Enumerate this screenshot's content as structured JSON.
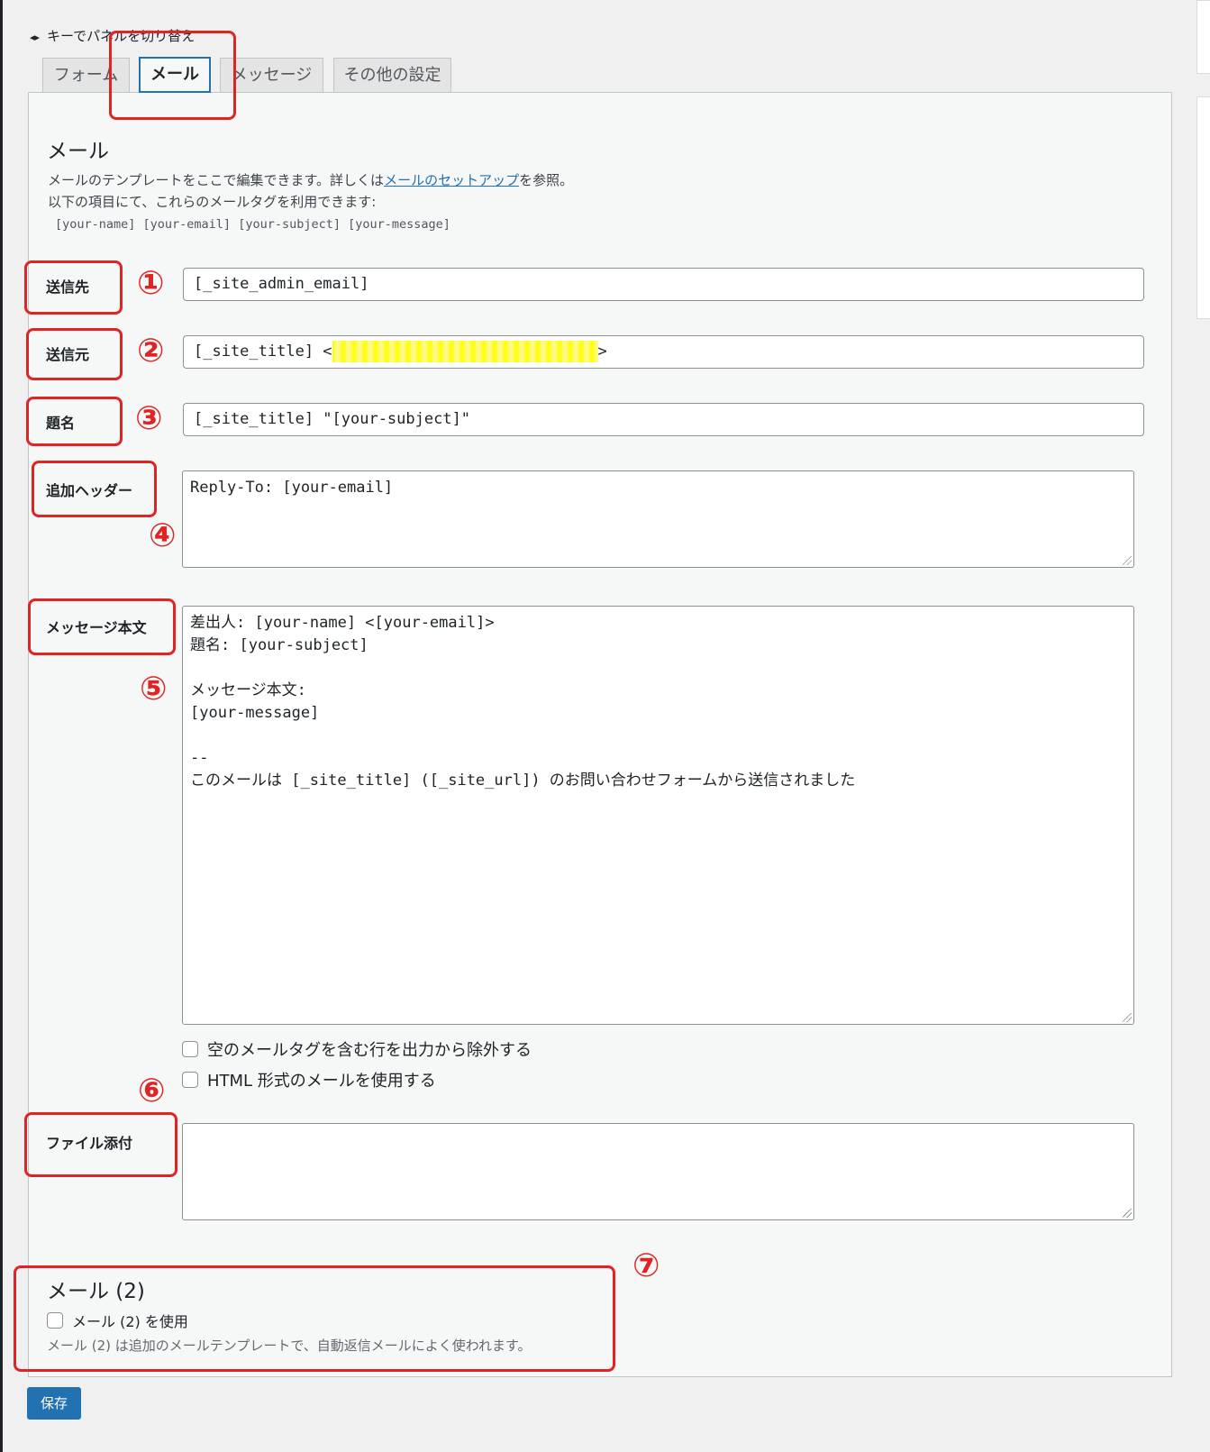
{
  "key_hint": "キーでパネルを切り替え",
  "tabs": [
    {
      "label": "フォーム"
    },
    {
      "label": "メール"
    },
    {
      "label": "メッセージ"
    },
    {
      "label": "その他の設定"
    }
  ],
  "mail": {
    "title": "メール",
    "desc_line1_pre": "メールのテンプレートをここで編集できます。詳しくは",
    "desc_link": "メールのセットアップ",
    "desc_line1_post": "を参照。",
    "desc_line2": "以下の項目にて、これらのメールタグを利用できます:",
    "tags": "[your-name] [your-email] [your-subject] [your-message]"
  },
  "fields": {
    "to": {
      "label": "送信先",
      "value": "[_site_admin_email]",
      "marker": "①"
    },
    "from": {
      "label": "送信元",
      "value_prefix": "[_site_title] <",
      "value_suffix": ">",
      "marker": "②"
    },
    "subject": {
      "label": "題名",
      "value": "[_site_title] \"[your-subject]\"",
      "marker": "③"
    },
    "headers": {
      "label": "追加ヘッダー",
      "value": "Reply-To: [your-email]",
      "marker": "④"
    },
    "body": {
      "label": "メッセージ本文",
      "value": "差出人: [your-name] <[your-email]>\n題名: [your-subject]\n\nメッセージ本文:\n[your-message]\n\n--\nこのメールは [_site_title] ([_site_url]) のお問い合わせフォームから送信されました",
      "marker": "⑤"
    },
    "exclude_blank": "空のメールタグを含む行を出力から除外する",
    "use_html": "HTML 形式のメールを使用する",
    "attachments": {
      "label": "ファイル添付",
      "value": "",
      "marker": "⑥"
    }
  },
  "mail2": {
    "title": "メール (2)",
    "checkbox_label": "メール (2) を使用",
    "desc": "メール (2) は追加のメールテンプレートで、自動返信メールによく使われます。",
    "marker": "⑦"
  },
  "save_label": "保存",
  "colors": {
    "accent": "#2271b1",
    "annotation": "#e02424",
    "highlight": "#ffff00"
  }
}
